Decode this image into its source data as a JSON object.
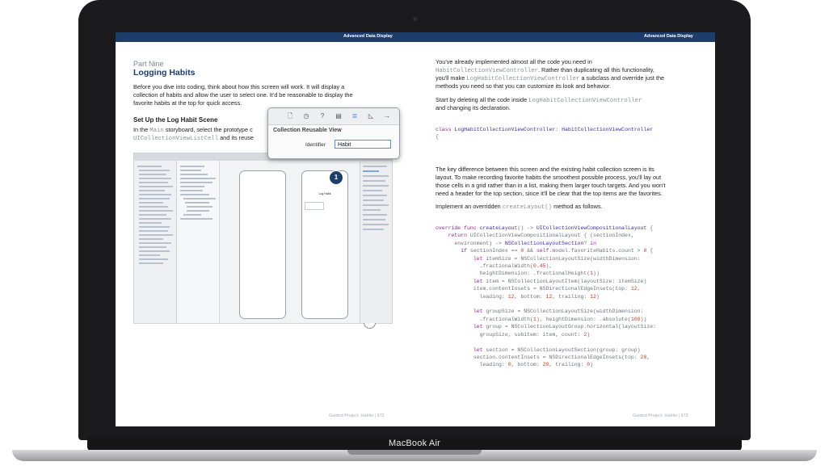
{
  "device": {
    "brand": "MacBook Air"
  },
  "header": {
    "left_title": "Advanced Data Display",
    "right_title": "Advanced Data Display"
  },
  "left": {
    "part": "Part Nine",
    "chapter": "Logging Habits",
    "intro_lines": [
      "Before you dive into coding, think about how this screen will work. It will display a",
      "collection of habits and allow the user to select one. It'd be reasonable to display the",
      "favorite habits at the top for quick access."
    ],
    "section_heading": "Set Up the Log Habit Scene",
    "section_line1_pre": "In the ",
    "section_line1_code": "Main",
    "section_line1_post": " storyboard, select the prototype c",
    "section_line2_code": "UICollectionViewListCell",
    "section_line2_post": " and its reuse",
    "screenshot": {
      "scene_title": "Log Habit"
    },
    "popup": {
      "title": "Collection Reusable View",
      "identifier_label": "Identifier",
      "identifier_value": "Habit"
    },
    "callout_number": "1",
    "footer": "Guided Project: Habits | 872"
  },
  "right": {
    "p1_l1": "You've already implemented almost all the code you need in",
    "p1_l2_code": "HabitCollectionViewController",
    "p1_l2_post": ". Rather than duplicating all this functionality,",
    "p1_l3_pre": "you'll make ",
    "p1_l3_code": "LogHabitCollectionViewController",
    "p1_l3_post": " a subclass and override just the",
    "p1_l4": "methods you need so that you can customize its look and behavior.",
    "p2_l1_pre": "Start by deleting all the code inside ",
    "p2_l1_code": "LogHabitCollectionViewController",
    "p2_l2": "and changing its declaration.",
    "p3_lines": [
      "The key difference between this screen and the existing habit collection screen is its",
      "layout. To make recording favorite habits the smoothest possible process, you'll lay out",
      "those cells in a grid rather than in a list, making them larger touch targets. And you won't",
      "need a header for the top section, since it'll be clear that the top items are the favorites."
    ],
    "p4_pre": "Implement an overridden ",
    "p4_code": "createLayout()",
    "p4_post": " method as follows.",
    "footer": "Guided Project: Habits | 873"
  },
  "colors": {
    "accent": "#1d3d6b",
    "keyword": "#9b2393",
    "type": "#3e29b0",
    "number": "#c43e1c"
  },
  "icons": [
    "file-inspector-icon",
    "history-icon",
    "help-icon",
    "identity-inspector-icon",
    "attributes-inspector-icon",
    "size-inspector-icon",
    "connections-inspector-icon",
    "zoom-icon"
  ]
}
